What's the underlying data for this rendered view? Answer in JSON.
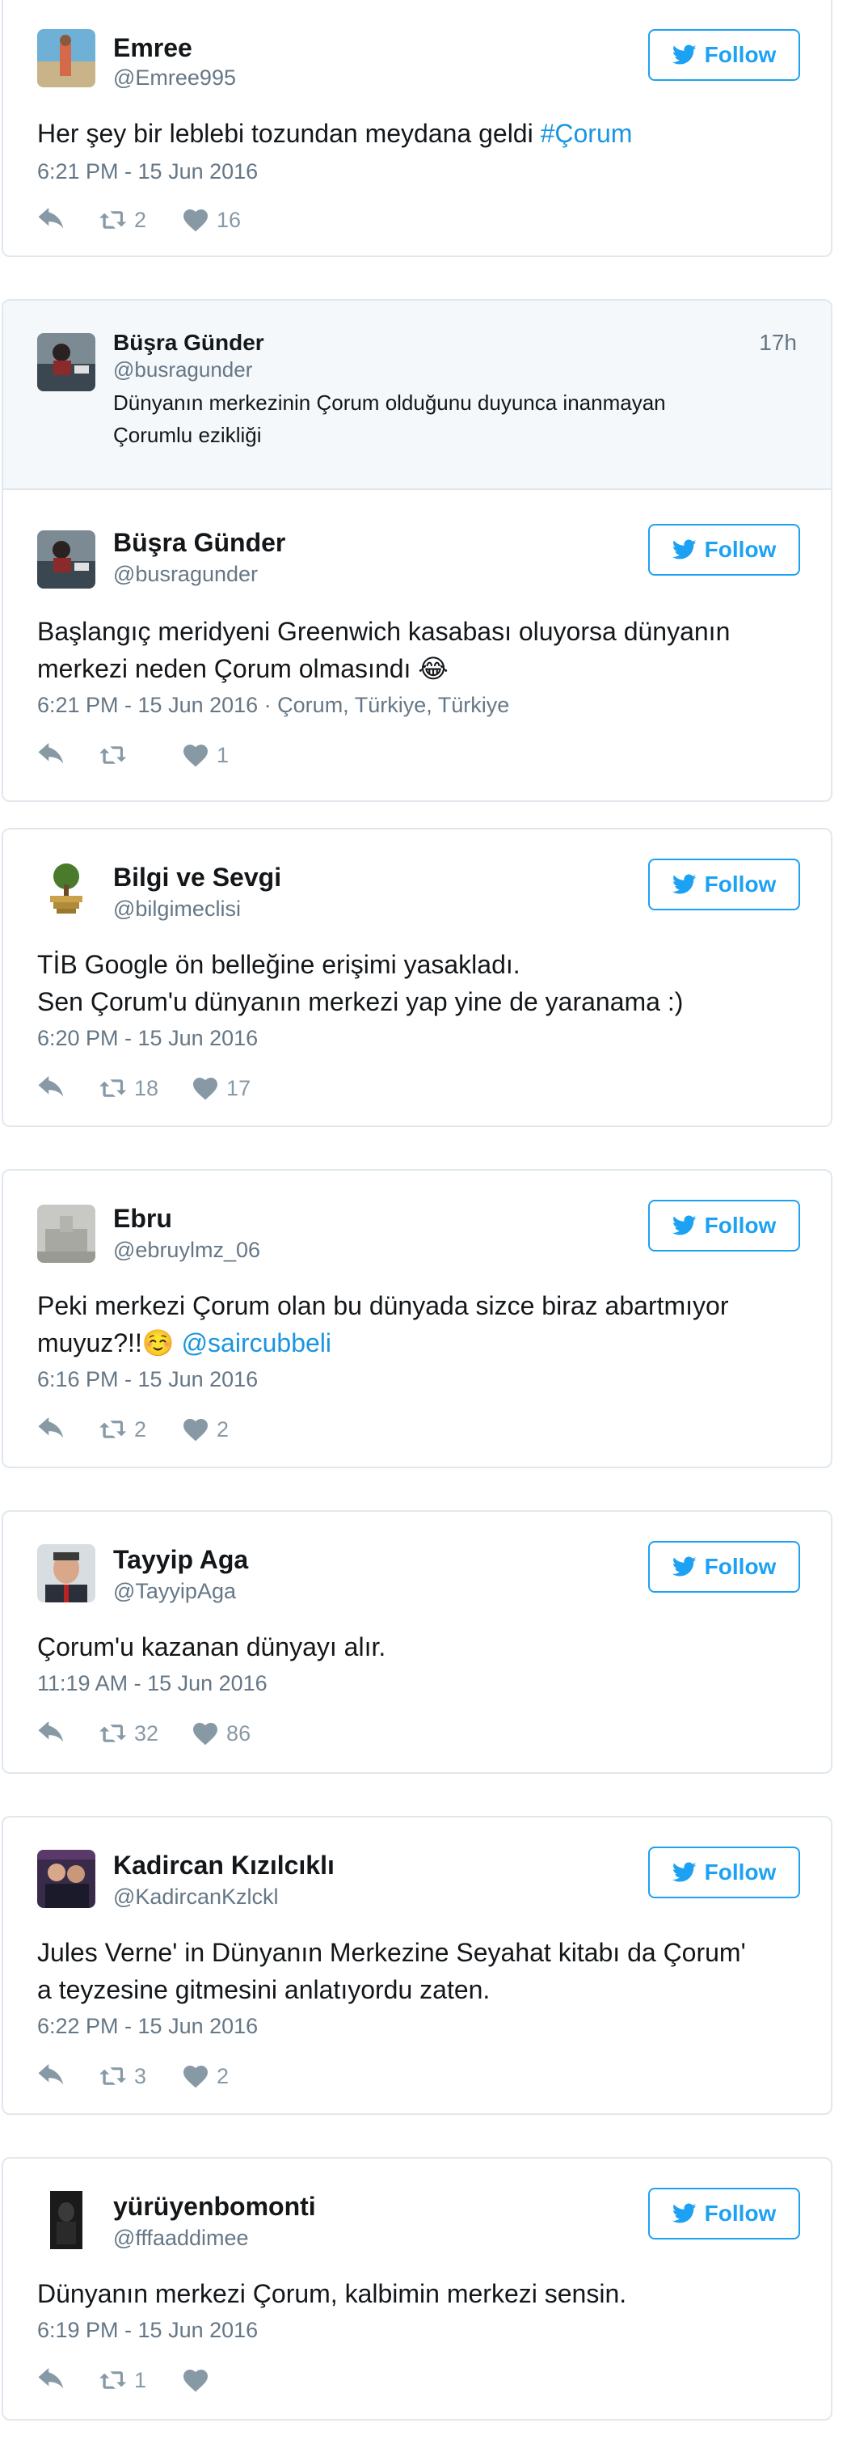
{
  "follow_label": "Follow",
  "tweets": [
    {
      "name": "Emree",
      "handle": "@Emree995",
      "text": "Her şey bir leblebi tozundan meydana geldi ",
      "link": "#Çorum",
      "meta": "6:21 PM - 15 Jun 2016",
      "retweets": "2",
      "likes": "16"
    },
    {
      "quoted": {
        "name": "Büşra Günder",
        "handle": "@busragunder",
        "time": "17h",
        "text": "Dünyanın merkezinin Çorum olduğunu duyunca inanmayan Çorumlu ezikliği"
      },
      "name": "Büşra Günder",
      "handle": "@busragunder",
      "text": "Başlangıç meridyeni Greenwich kasabası oluyorsa dünyanın merkezi neden Çorum olmasındı ",
      "emoji": "😂",
      "meta": "6:21 PM - 15 Jun 2016 · Çorum, Türkiye, Türkiye",
      "retweets": "",
      "likes": "1"
    },
    {
      "name": "Bilgi ve Sevgi",
      "handle": "@bilgimeclisi",
      "text_line1": "TİB Google ön belleğine erişimi yasakladı.",
      "text_line2": "Sen Çorum'u dünyanın merkezi yap yine de yaranama :)",
      "meta": "6:20 PM - 15 Jun 2016",
      "retweets": "18",
      "likes": "17"
    },
    {
      "name": "Ebru",
      "handle": "@ebruylmz_06",
      "text": "Peki merkezi Çorum olan bu dünyada sizce biraz abartmıyor muyuz?!!",
      "emoji": "☺️",
      "link": "@saircubbeli",
      "meta": "6:16 PM - 15 Jun 2016",
      "retweets": "2",
      "likes": "2"
    },
    {
      "name": "Tayyip Aga",
      "handle": "@TayyipAga",
      "text": "Çorum'u kazanan dünyayı alır.",
      "meta": "11:19 AM - 15 Jun 2016",
      "retweets": "32",
      "likes": "86"
    },
    {
      "name": "Kadircan Kızılcıklı",
      "handle": "@KadircanKzlckl",
      "text": "Jules Verne' in Dünyanın Merkezine Seyahat kitabı da Çorum' a teyzesine gitmesini anlatıyordu zaten.",
      "meta": "6:22 PM - 15 Jun 2016",
      "retweets": "3",
      "likes": "2"
    },
    {
      "name": "yürüyenbomonti",
      "handle": "@fffaaddimee",
      "text": "Dünyanın merkezi Çorum, kalbimin merkezi sensin.",
      "meta": "6:19 PM - 15 Jun 2016",
      "retweets": "1",
      "likes": ""
    }
  ],
  "colors": {
    "accent": "#1da1f2",
    "link": "#1b95e0",
    "muted": "#657786",
    "border": "#e1e8ed"
  }
}
